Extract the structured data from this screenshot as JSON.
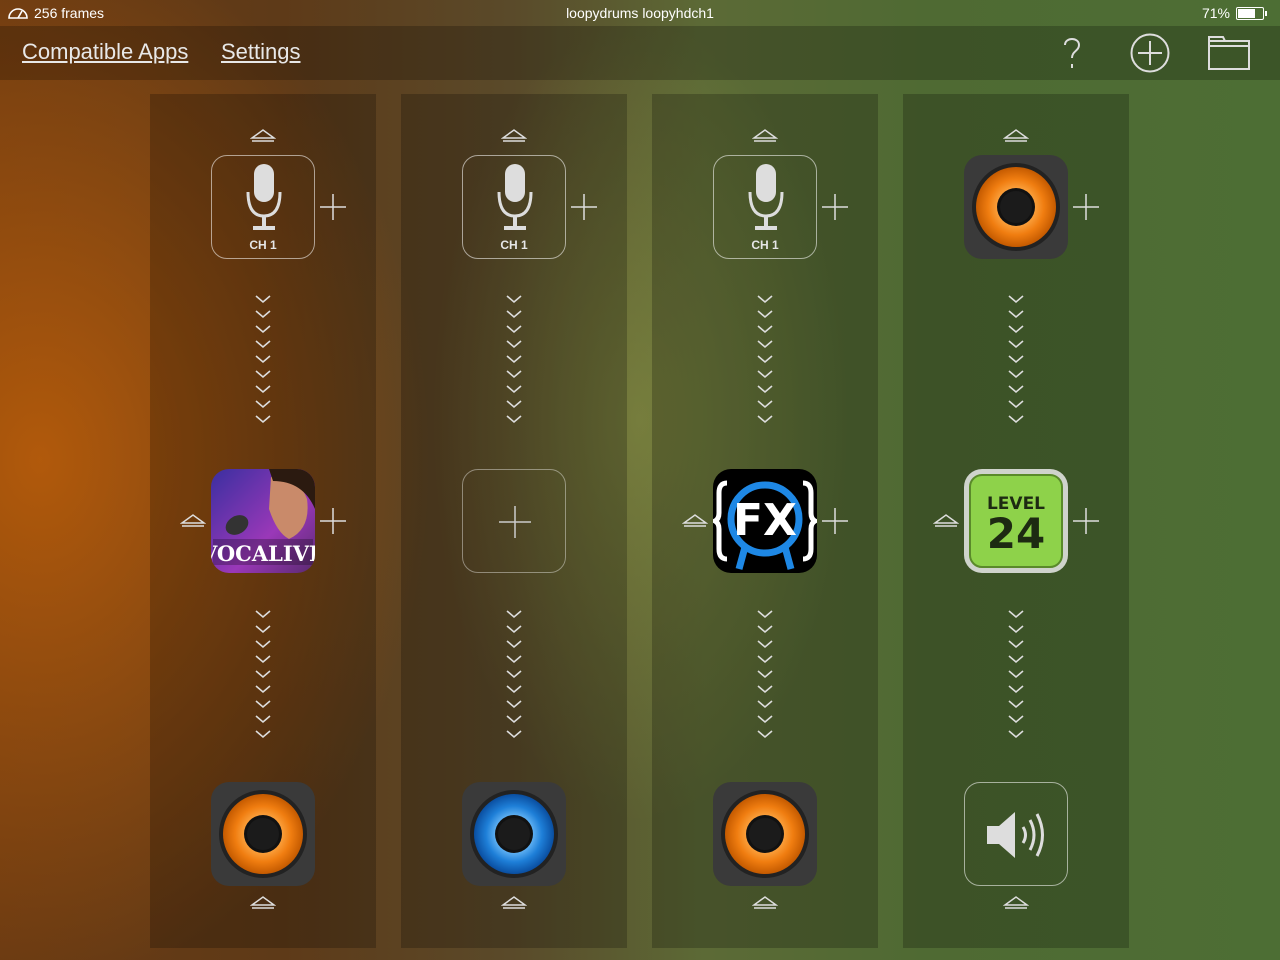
{
  "status_bar": {
    "frames": "256 frames",
    "title": "loopydrums loopyhdch1",
    "battery": "71%",
    "battery_level": 0.71
  },
  "nav": {
    "compatible_apps": "Compatible Apps",
    "settings": "Settings"
  },
  "channels": [
    {
      "input": "CH 1",
      "effect": "VocaLive",
      "output": "Loopy HD"
    },
    {
      "input": "CH 1",
      "effect": "",
      "output": "Loopy Masterpiece"
    },
    {
      "input": "CH 1",
      "effect": "FX",
      "output": "Loopy HD"
    },
    {
      "input": "Loopy HD",
      "effect": "Level 24",
      "output": "Speaker"
    }
  ],
  "icons": {
    "vocalive_text": "VOCALIVE",
    "fx_text": "FX",
    "level_text": "LEVEL",
    "level_number": "24"
  },
  "colors": {
    "loopy_orange": "#f07d10",
    "loopy_blue": "#1e7fd8",
    "level_green": "#8ed24a"
  }
}
